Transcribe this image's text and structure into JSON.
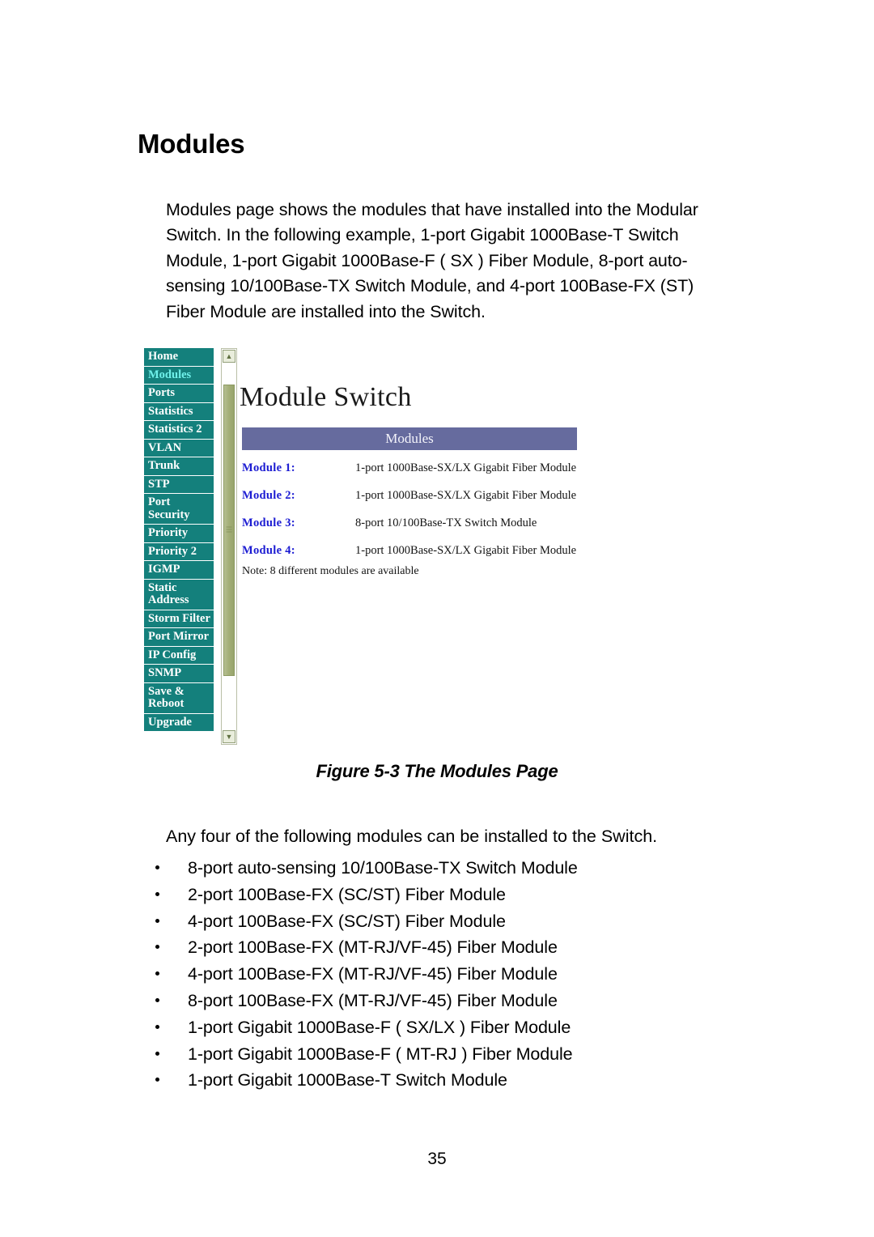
{
  "document": {
    "section_title": "Modules",
    "intro_paragraph": "Modules page shows the modules that have installed into the Modular Switch. In the following example, 1-port Gigabit 1000Base-T Switch Module, 1-port Gigabit 1000Base-F ( SX ) Fiber Module, 8-port auto-sensing 10/100Base-TX Switch Module, and 4-port 100Base-FX (ST) Fiber Module are installed into the Switch.",
    "figure_caption": "Figure 5-3 The Modules Page",
    "lead_line": "Any four of the following modules can be installed to the Switch.",
    "page_number": "35"
  },
  "screenshot": {
    "sidebar": {
      "items": [
        {
          "label": "Home",
          "selected": false
        },
        {
          "label": "Modules",
          "selected": true
        },
        {
          "label": "Ports",
          "selected": false
        },
        {
          "label": "Statistics",
          "selected": false
        },
        {
          "label": "Statistics 2",
          "selected": false
        },
        {
          "label": "VLAN",
          "selected": false
        },
        {
          "label": "Trunk",
          "selected": false
        },
        {
          "label": "STP",
          "selected": false
        },
        {
          "label": "Port\nSecurity",
          "selected": false
        },
        {
          "label": "Priority",
          "selected": false
        },
        {
          "label": "Priority 2",
          "selected": false
        },
        {
          "label": "IGMP",
          "selected": false
        },
        {
          "label": "Static\nAddress",
          "selected": false
        },
        {
          "label": "Storm Filter",
          "selected": false
        },
        {
          "label": "Port Mirror",
          "selected": false
        },
        {
          "label": "IP Config",
          "selected": false
        },
        {
          "label": "SNMP",
          "selected": false
        },
        {
          "label": "Save &\nReboot",
          "selected": false
        },
        {
          "label": "Upgrade",
          "selected": false
        }
      ]
    },
    "scrollbar": {
      "up_arrow": "▲",
      "down_arrow": "▼"
    },
    "main": {
      "heading": "Module Switch",
      "table_header": "Modules",
      "rows": [
        {
          "label": "Module 1:",
          "value": "1-port 1000Base-SX/LX Gigabit Fiber Module"
        },
        {
          "label": "Module 2:",
          "value": "1-port 1000Base-SX/LX Gigabit Fiber Module"
        },
        {
          "label": "Module 3:",
          "value": "8-port 10/100Base-TX Switch Module"
        },
        {
          "label": "Module 4:",
          "value": "1-port 1000Base-SX/LX Gigabit Fiber Module"
        }
      ],
      "note": "Note: 8 different modules are available"
    },
    "colors": {
      "sidebar_bg": "#14807c",
      "sidebar_selected_text": "#6ff0ea",
      "table_header_bg": "#666b9e",
      "module_label": "#1b1bd2",
      "scrollbar_thumb": "#a5b079"
    }
  },
  "module_list": [
    "8-port auto-sensing 10/100Base-TX Switch Module",
    "2-port 100Base-FX (SC/ST) Fiber Module",
    "4-port 100Base-FX (SC/ST) Fiber Module",
    "2-port 100Base-FX (MT-RJ/VF-45) Fiber Module",
    "4-port 100Base-FX (MT-RJ/VF-45) Fiber Module",
    "8-port 100Base-FX (MT-RJ/VF-45) Fiber Module",
    "1-port Gigabit 1000Base-F ( SX/LX ) Fiber Module",
    "1-port Gigabit 1000Base-F ( MT-RJ ) Fiber Module",
    "1-port Gigabit 1000Base-T Switch Module"
  ]
}
